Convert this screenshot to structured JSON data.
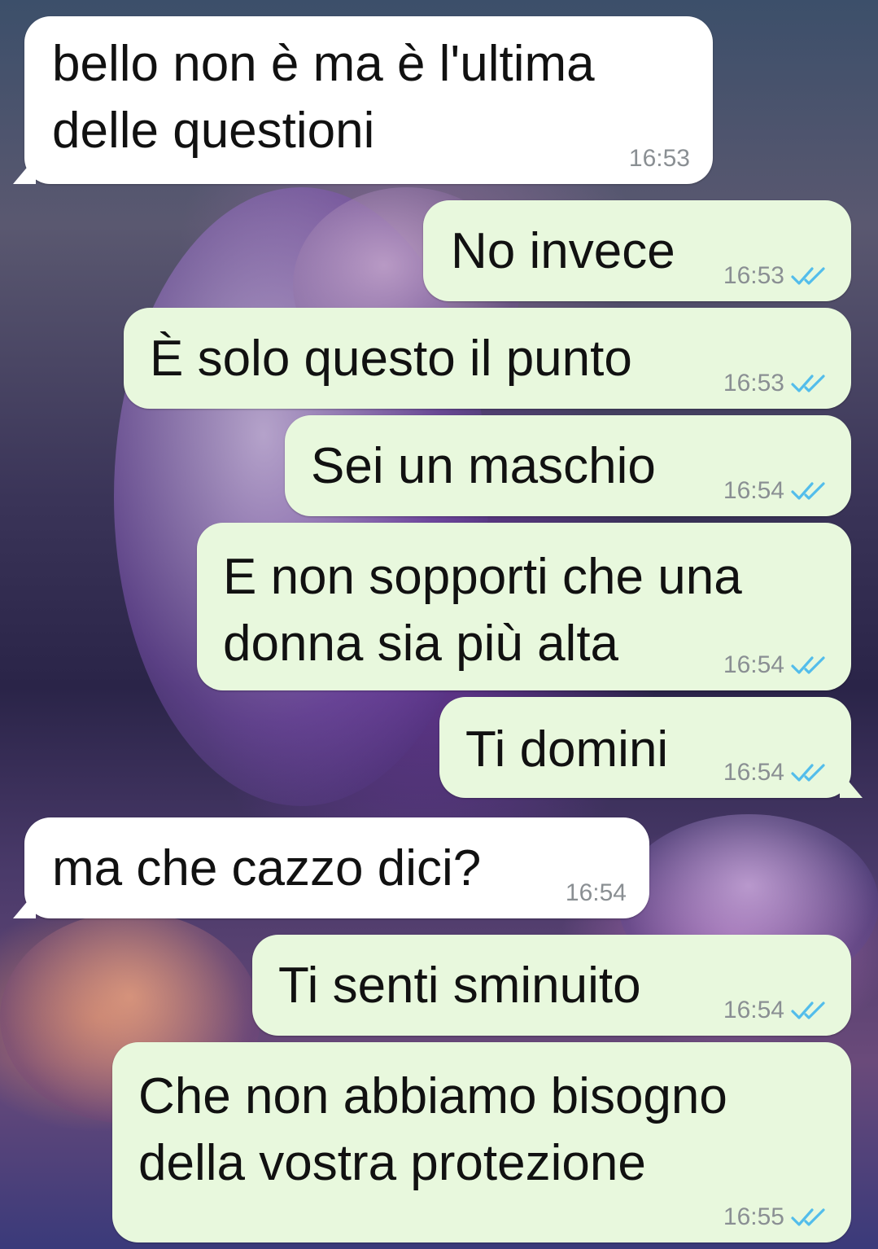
{
  "messages": [
    {
      "direction": "incoming",
      "lines": [
        "bello non è ma è l'ultima",
        "delle questioni"
      ],
      "time": "16:53"
    },
    {
      "direction": "outgoing",
      "lines": [
        "No invece"
      ],
      "time": "16:53",
      "status": "read-double-check"
    },
    {
      "direction": "outgoing",
      "lines": [
        "È solo questo il punto"
      ],
      "time": "16:53",
      "status": "read-double-check"
    },
    {
      "direction": "outgoing",
      "lines": [
        "Sei un maschio"
      ],
      "time": "16:54",
      "status": "read-double-check"
    },
    {
      "direction": "outgoing",
      "lines": [
        "E non sopporti che una",
        "donna sia più alta"
      ],
      "time": "16:54",
      "status": "read-double-check"
    },
    {
      "direction": "outgoing",
      "lines": [
        "Ti domini"
      ],
      "time": "16:54",
      "status": "read-double-check"
    },
    {
      "direction": "incoming",
      "lines": [
        "ma che cazzo dici?"
      ],
      "time": "16:54"
    },
    {
      "direction": "outgoing",
      "lines": [
        "Ti senti sminuito"
      ],
      "time": "16:54",
      "status": "read-double-check"
    },
    {
      "direction": "outgoing",
      "lines": [
        "Che non abbiamo bisogno",
        "della vostra protezione"
      ],
      "time": "16:55",
      "status": "read-double-check"
    }
  ],
  "colors": {
    "incoming_bubble": "#ffffff",
    "outgoing_bubble": "#e8f8dd",
    "read_ticks": "#53bdeb",
    "timestamp": "#8a8f93"
  }
}
